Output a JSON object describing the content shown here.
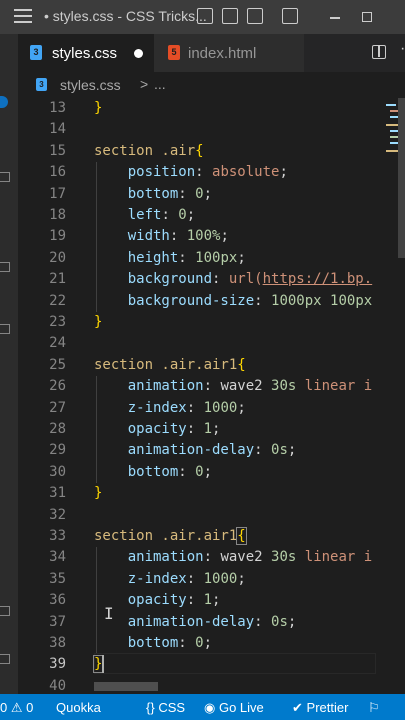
{
  "titlebar": {
    "title": "• styles.css - CSS Tricks..."
  },
  "tabs": [
    {
      "label": "styles.css",
      "icon": "css-file-icon",
      "modified": true
    },
    {
      "label": "index.html",
      "icon": "html-file-icon"
    }
  ],
  "icons": {
    "css_glyph": "3",
    "html_glyph": "5",
    "more": "···"
  },
  "breadcrumb": {
    "file": "styles.css",
    "separator": ">",
    "symbol": "..."
  },
  "editor": {
    "line_numbers": [
      "13",
      "14",
      "15",
      "16",
      "17",
      "18",
      "19",
      "20",
      "21",
      "22",
      "23",
      "24",
      "25",
      "26",
      "27",
      "28",
      "29",
      "30",
      "31",
      "32",
      "33",
      "34",
      "35",
      "36",
      "37",
      "38",
      "39",
      "40"
    ],
    "current_line": "39",
    "block1": {
      "selector": "section .air",
      "position": "position",
      "position_val": "absolute",
      "bottom": "bottom",
      "bottom_val": "0",
      "left": "left",
      "left_val": "0",
      "width": "width",
      "width_val": "100%",
      "height": "height",
      "height_val": "100px",
      "background": "background",
      "url_fn": "url(",
      "url_text": "https://1.bp.",
      "bgsize": "background-size",
      "bgsize_val1": "1000px",
      "bgsize_val2": "100px"
    },
    "block2": {
      "selector": "section .air.air1",
      "animation": "animation",
      "anim_name": "wave2",
      "anim_dur": "30s",
      "anim_rest": "linear i",
      "zindex": "z-index",
      "zindex_val": "1000",
      "opacity": "opacity",
      "opacity_val": "1",
      "delay": "animation-delay",
      "delay_val": "0s",
      "bottom": "bottom",
      "bottom_val": "0"
    },
    "block3": {
      "selector": "section .air.air1",
      "animation": "animation",
      "anim_name": "wave2",
      "anim_dur": "30s",
      "anim_rest": "linear i",
      "zindex": "z-index",
      "zindex_val": "1000",
      "opacity": "opacity",
      "opacity_val": "1",
      "delay": "animation-delay",
      "delay_val": "0s",
      "bottom": "bottom",
      "bottom_val": "0"
    },
    "ibeam": "I"
  },
  "status": {
    "remote": "0",
    "warnings": "0",
    "quokka": "Quokka",
    "language": "CSS",
    "golive": "Go Live",
    "prettier": "Prettier",
    "remote_icon": "⚐"
  },
  "colors": {
    "status_bar": "#007acc",
    "selector": "#d7ba7d",
    "property": "#9cdcfe",
    "string_value": "#ce9178",
    "number": "#b5cea8",
    "bracket": "#ffd700"
  }
}
